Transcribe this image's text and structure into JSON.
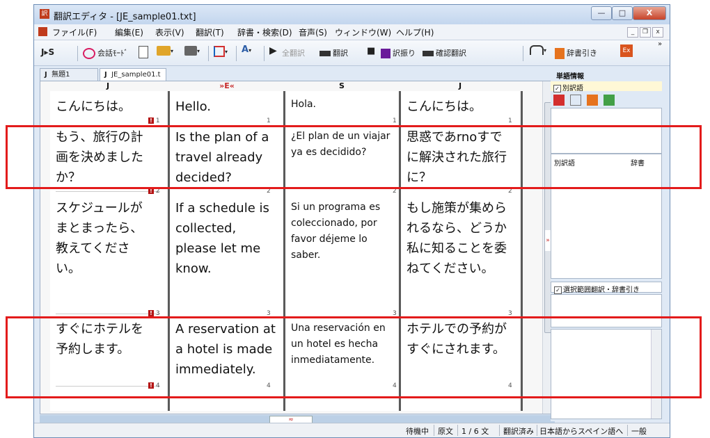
{
  "window": {
    "title": "翻訳エディタ - [JE_sample01.txt]",
    "app_icon_text": "訳",
    "controls": {
      "minimize": "—",
      "maximize": "□",
      "close": "X"
    }
  },
  "menubar": {
    "items": [
      "ファイル(F)",
      "編集(E)",
      "表示(V)",
      "翻訳(T)",
      "辞書・検索(D)",
      "音声(S)",
      "ウィンドウ(W)",
      "ヘルプ(H)"
    ],
    "mdi": {
      "minimize": "_",
      "restore": "❐",
      "close": "x"
    }
  },
  "toolbar": {
    "direction": "J▸S",
    "conversation_mode": "会話ﾓｰﾄﾞ",
    "translate_all": "全翻訳",
    "translate": "翻訳",
    "furigana": "訳振り",
    "confirm_translate": "確認翻訳",
    "dictionary_lookup": "辞書引き",
    "overflow": "»"
  },
  "tabs": [
    {
      "lang": "J",
      "label": "無題1"
    },
    {
      "lang": "J",
      "label": "JE_sample01.t"
    }
  ],
  "columns": {
    "headers": [
      "J",
      "»E«",
      "S",
      "J"
    ]
  },
  "rows": [
    {
      "num": "1",
      "ja": "こんにちは。",
      "en": "Hello.",
      "es": "Hola.",
      "back": "こんにちは。"
    },
    {
      "num": "2",
      "ja": "もう、旅行の計画を決めましたか？",
      "en": "Is the plan of a travel already decided?",
      "es": "¿El plan de un viajar ya es decidido?",
      "back": "思惑であrnoすでに解決された旅行に？"
    },
    {
      "num": "3",
      "ja": "スケジュールがまとまったら、教えてください。",
      "en": "If a schedule is collected, please let me know.",
      "es": "Si un programa es coleccionado, por favor déjeme lo saber.",
      "back": "もし施策が集められるなら、どうか私に知ることを委ねてください。"
    },
    {
      "num": "4",
      "ja": "すぐにホテルを予約します。",
      "en": "A reservation at a hotel is made immediately.",
      "es": "Una reservación en un hotel es hecha inmediatamente.",
      "back": "ホテルでの予約がすぐにされます。"
    }
  ],
  "rightpanel": {
    "title": "単語情報",
    "alt_words_label": "別訳語",
    "col_alt": "別訳語",
    "col_dict": "辞書",
    "selection_label": "選択範囲翻訳・辞書引き",
    "expand_glyph": "»"
  },
  "hscroll_glyph": "≈",
  "status": {
    "state": "待機中",
    "source": "原文",
    "position": "1 / 6 文",
    "translated": "翻訳済み",
    "direction": "日本語からスペイン語へ",
    "field": "一般"
  },
  "colors": {
    "highlight_box": "#e31b1b",
    "flag_red": "#b41414"
  }
}
